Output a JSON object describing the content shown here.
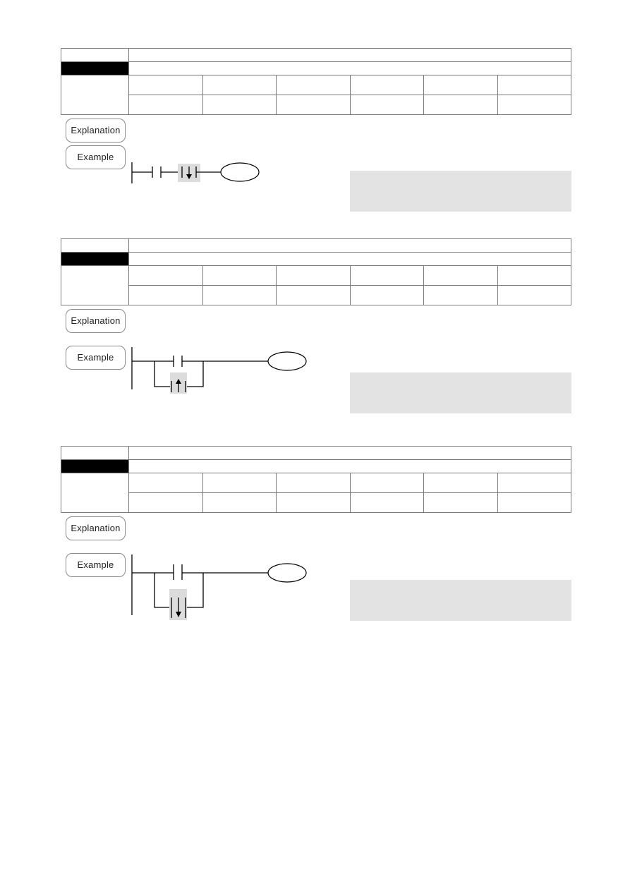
{
  "sections": [
    {
      "id": "section-1",
      "explanation_label": "Explanation",
      "example_label": "Example",
      "diagram": "falling-edge-series",
      "table": {
        "title": "",
        "subtitle": "",
        "row3": [
          "",
          "",
          "",
          "",
          "",
          ""
        ],
        "row4": [
          "",
          "",
          "",
          "",
          "",
          ""
        ]
      }
    },
    {
      "id": "section-2",
      "explanation_label": "Explanation",
      "example_label": "Example",
      "diagram": "rising-edge-parallel",
      "table": {
        "title": "",
        "subtitle": "",
        "row3": [
          "",
          "",
          "",
          "",
          "",
          ""
        ],
        "row4": [
          "",
          "",
          "",
          "",
          "",
          ""
        ]
      }
    },
    {
      "id": "section-3",
      "explanation_label": "Explanation",
      "example_label": "Example",
      "diagram": "falling-edge-parallel",
      "table": {
        "title": "",
        "subtitle": "",
        "row3": [
          "",
          "",
          "",
          "",
          "",
          ""
        ],
        "row4": [
          "",
          "",
          "",
          "",
          "",
          ""
        ]
      }
    }
  ],
  "colors": {
    "header_cell": "#000000",
    "note_box": "#e3e3e3",
    "border": "#7a7a7a"
  }
}
